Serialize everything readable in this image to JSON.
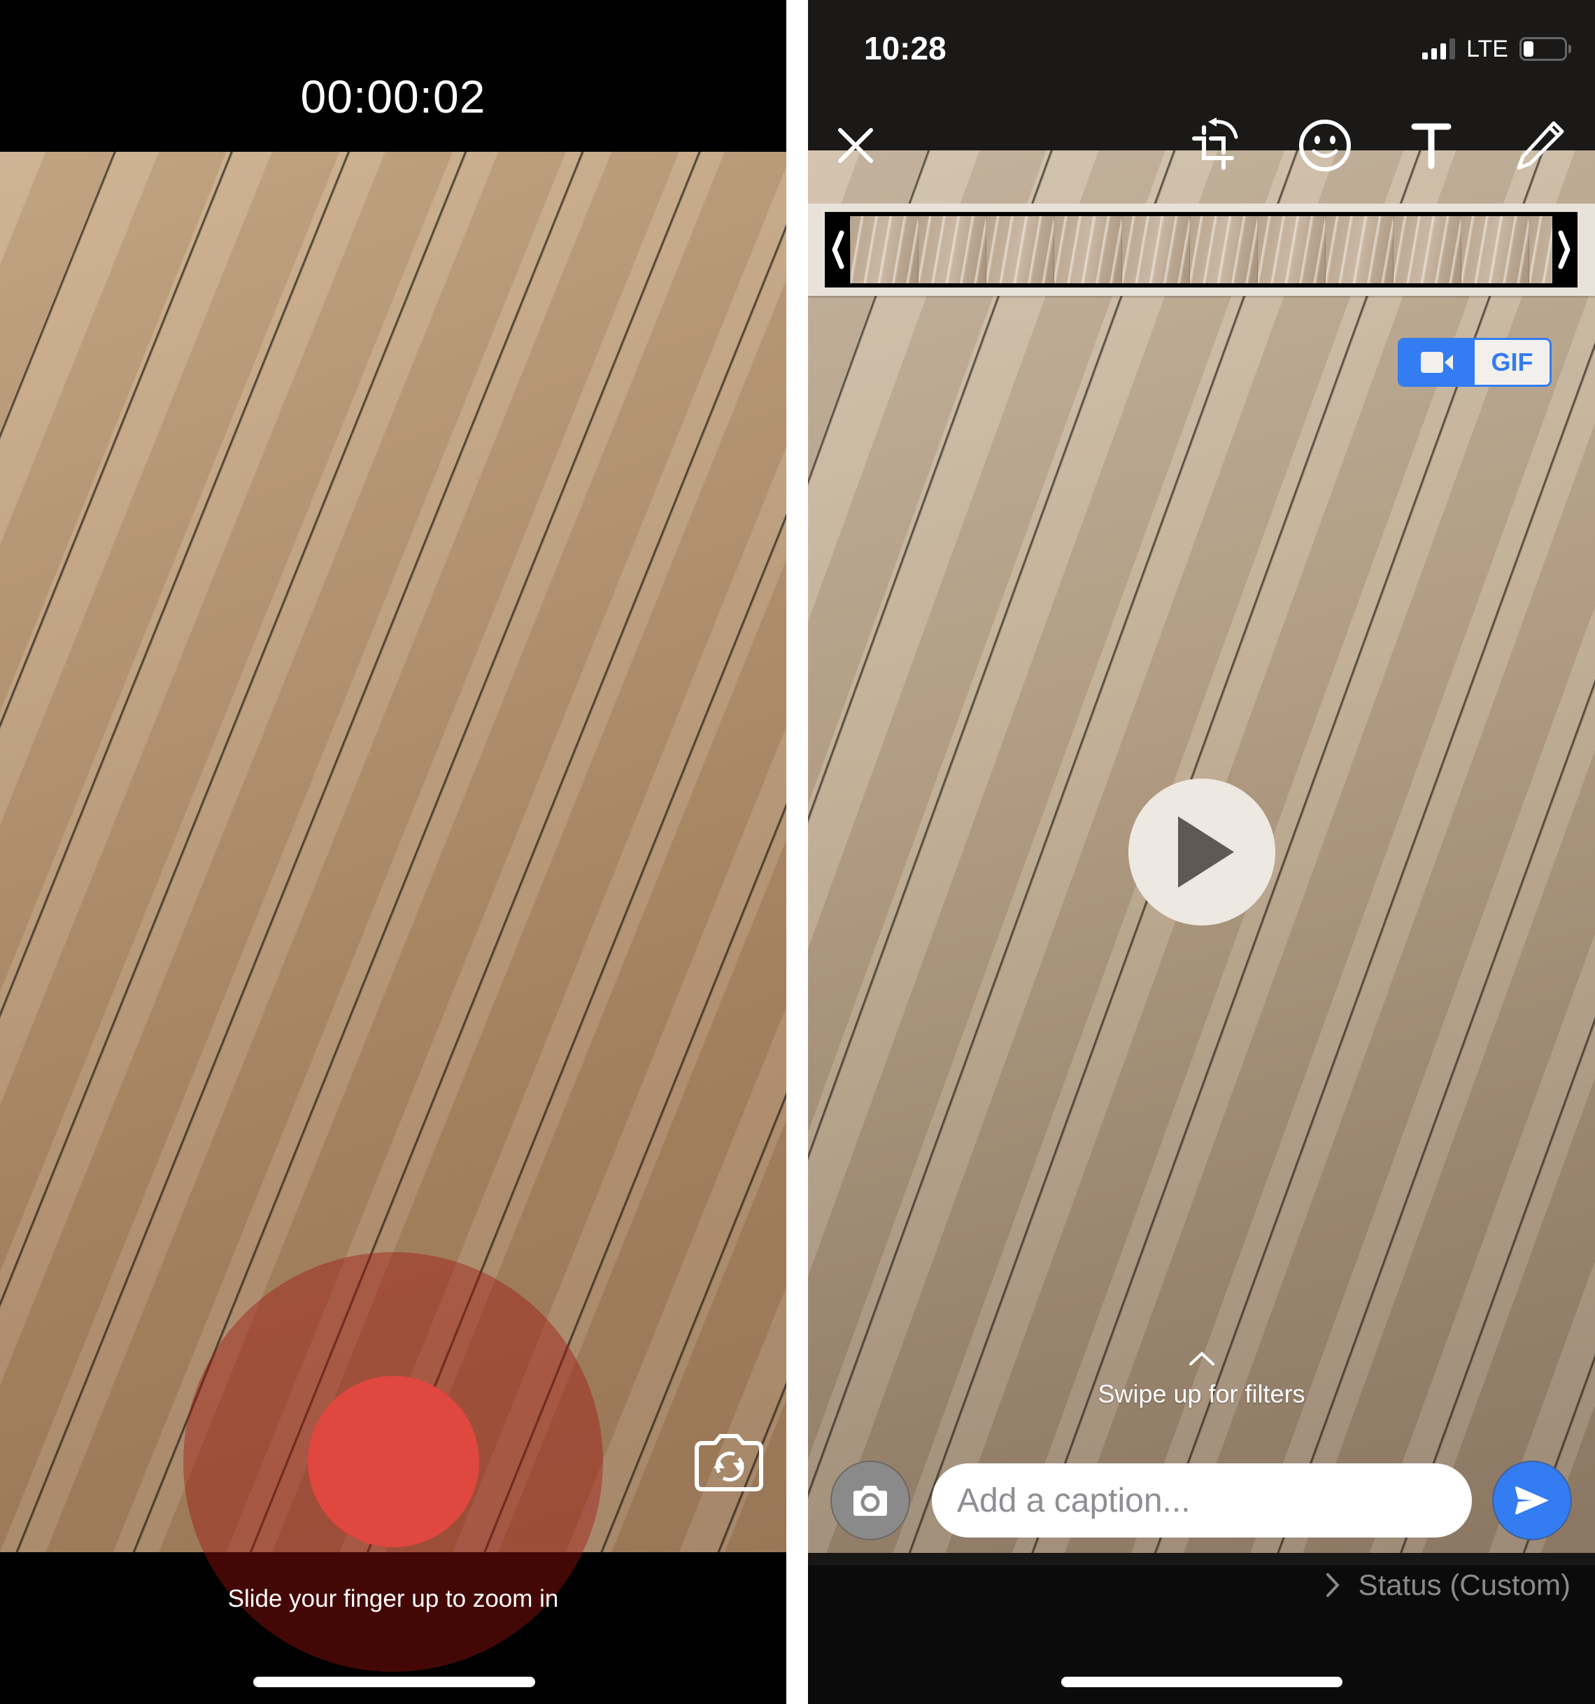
{
  "left_screen": {
    "recording_timer": "00:00:02",
    "record_button": {
      "state": "recording",
      "color": "#e0473e"
    },
    "flip_camera_icon": "camera-flip-icon",
    "hint_text": "Slide your finger up to zoom in"
  },
  "right_screen": {
    "status_bar": {
      "time": "10:28",
      "signal_bars": 3,
      "signal_bars_total": 4,
      "network": "LTE",
      "battery_level": 0.25
    },
    "toolbar": {
      "close_icon": "close-icon",
      "crop_rotate_icon": "crop-rotate-icon",
      "emoji_icon": "smiley-icon",
      "text_icon": "text-icon",
      "draw_icon": "pencil-icon"
    },
    "trimmer": {
      "frame_count": 11,
      "left_handle": "trim-start-handle",
      "right_handle": "trim-end-handle"
    },
    "mode_toggle": {
      "options": [
        "Video",
        "GIF"
      ],
      "selected": "Video",
      "gif_label": "GIF",
      "accent": "#337cf2"
    },
    "play_icon": "play-icon",
    "swipe_hint": "Swipe up for filters",
    "caption": {
      "placeholder": "Add a caption...",
      "value": ""
    },
    "send_color": "#337cf2",
    "destination": "Status (Custom)"
  }
}
